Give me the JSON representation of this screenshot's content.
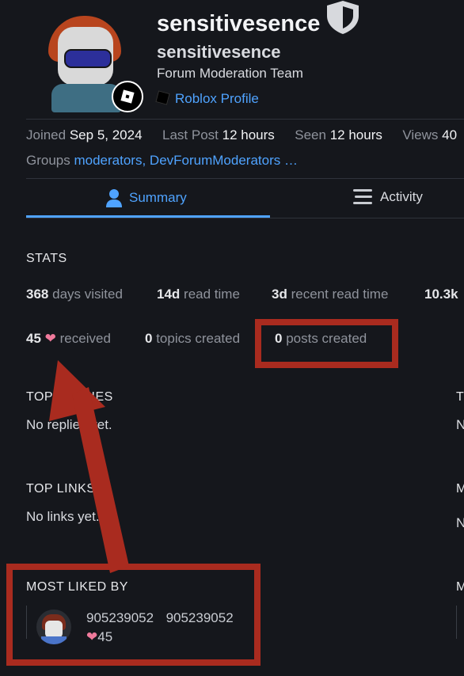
{
  "profile": {
    "username": "sensitivesence",
    "full_name": "sensitivesence",
    "title": "Forum Moderation Team",
    "profile_link": "Roblox Profile"
  },
  "meta": {
    "joined_label": "Joined",
    "joined_value": "Sep 5, 2024",
    "last_post_label": "Last Post",
    "last_post_value": "12 hours",
    "seen_label": "Seen",
    "seen_value": "12 hours",
    "views_label": "Views",
    "views_value": "40",
    "groups_label": "Groups",
    "group_1": "moderators,",
    "group_2": "DevForumModerators …"
  },
  "tabs": {
    "summary": "Summary",
    "activity": "Activity"
  },
  "stats": {
    "heading": "STATS",
    "days_visited_value": "368",
    "days_visited_label": "days visited",
    "read_time_value": "14d",
    "read_time_label": "read time",
    "recent_read_value": "3d",
    "recent_read_label": "recent read time",
    "extra_value": "10.3k",
    "likes_received_value": "45",
    "likes_received_label": "received",
    "topics_created_value": "0",
    "topics_created_label": "topics created",
    "posts_created_value": "0",
    "posts_created_label": "posts created"
  },
  "sections": {
    "top_replies_heading": "TOP REPLIES",
    "top_replies_empty": "No replies yet.",
    "top_links_heading": "TOP LINKS",
    "top_links_empty": "No links yet.",
    "most_liked_heading": "MOST LIKED BY",
    "right_col_1_heading": "T",
    "right_col_1_text": "N",
    "right_col_2_heading": "M",
    "right_col_2_text": "N",
    "right_col_3_heading": "M"
  },
  "most_liked": {
    "username": "905239052",
    "name": "905239052",
    "count": "45"
  },
  "colors": {
    "accent": "#4fa3ff",
    "annotation_red": "#a92b1f",
    "heart": "#f07a9c"
  }
}
